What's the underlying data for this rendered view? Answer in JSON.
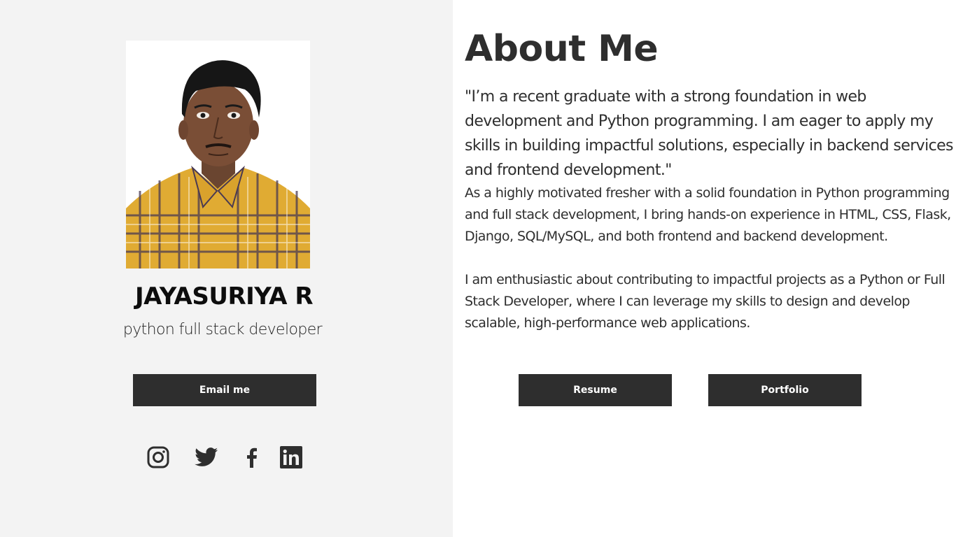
{
  "profile": {
    "name": "JAYASURIYA R",
    "role": "python full stack developer",
    "email_button": "Email me"
  },
  "social": [
    {
      "icon": "instagram-icon"
    },
    {
      "icon": "twitter-icon"
    },
    {
      "icon": "facebook-icon"
    },
    {
      "icon": "linkedin-icon"
    }
  ],
  "about": {
    "title": "About Me",
    "quote": "\"I’m a recent graduate with a strong foundation in web development and Python programming. I am eager to apply my skills in building impactful solutions, especially in backend services and frontend development.\"",
    "paragraph_1": "As a highly motivated fresher with a solid foundation in Python programming and full stack development, I bring hands-on experience in HTML, CSS, Flask, Django, SQL/MySQL, and both frontend and backend development.",
    "paragraph_2": "I am enthusiastic about contributing to impactful projects as a Python or Full Stack Developer, where I can leverage my skills to design and develop scalable, high-performance web applications.",
    "resume_button": "Resume",
    "portfolio_button": "Portfolio"
  },
  "colors": {
    "left_panel_bg": "#f3f3f3",
    "button_bg": "#2e2e2e",
    "button_text": "#ffffff",
    "text": "#2e2e2e"
  }
}
